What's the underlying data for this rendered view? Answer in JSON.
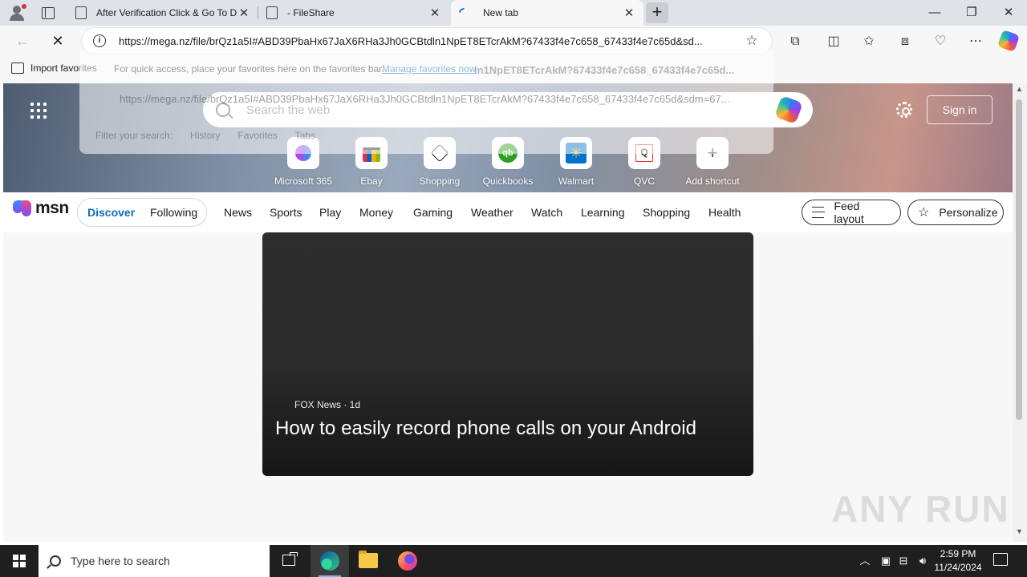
{
  "tabs": [
    {
      "title": "After Verification Click & Go To D",
      "active": false
    },
    {
      "title": "- FileShare",
      "active": false
    },
    {
      "title": "New tab",
      "active": true
    }
  ],
  "toolbar": {
    "url": "https://mega.nz/file/brQz1a5I#ABD39PbaHx67JaX6RHa3Jh0GCBtdln1NpET8ETcrAkM?67433f4e7c658_67433f4e7c65d&sd..."
  },
  "favorites_bar": {
    "import_label": "Import favorites",
    "message": "For quick access, place your favorites here on the favorites bar.",
    "manage_link": "Manage favorites now"
  },
  "dropdown_ghost": {
    "suggestion_bold": "ln1NpET8ETcrAkM?67433f4e7c658_67433f4e7c65d...",
    "suggestion_url": "https://mega.nz/file/brQz1a5I#ABD39PbaHx67JaX6RHa3Jh0GCBtdln1NpET8ETcrAkM?67433f4e7c658_67433f4e7c65d&sdm=67...",
    "filter_label": "Filter your search:",
    "filters": [
      "History",
      "Favorites",
      "Tabs"
    ]
  },
  "newtab": {
    "search_placeholder": "Search the web",
    "signin_label": "Sign in",
    "shortcuts": [
      {
        "label": "Microsoft 365",
        "icon": "microsoft365-icon"
      },
      {
        "label": "Ebay",
        "icon": "ebay-bag-icon"
      },
      {
        "label": "Shopping",
        "icon": "tag-icon"
      },
      {
        "label": "Quickbooks",
        "icon": "quickbooks-icon"
      },
      {
        "label": "Walmart",
        "icon": "walmart-spark-icon"
      },
      {
        "label": "QVC",
        "icon": "qvc-icon"
      },
      {
        "label": "Add shortcut",
        "icon": "plus-icon"
      }
    ]
  },
  "msn": {
    "logo_text": "msn",
    "discover": "Discover",
    "following": "Following",
    "nav": [
      "News",
      "Sports",
      "Play",
      "Money",
      "Gaming",
      "Weather",
      "Watch",
      "Learning",
      "Shopping",
      "Health"
    ],
    "feed_layout": "Feed layout",
    "personalize": "Personalize"
  },
  "card": {
    "source": "FOX News · 1d",
    "headline": "How to easily record phone calls on your Android"
  },
  "watermark": "ANY RUN",
  "taskbar": {
    "search_placeholder": "Type here to search",
    "time": "2:59 PM",
    "date": "11/24/2024"
  },
  "colors": {
    "accent": "#0f6cbd",
    "taskbar": "#1f1f1f",
    "tabstrip": "#dfe3e8"
  }
}
